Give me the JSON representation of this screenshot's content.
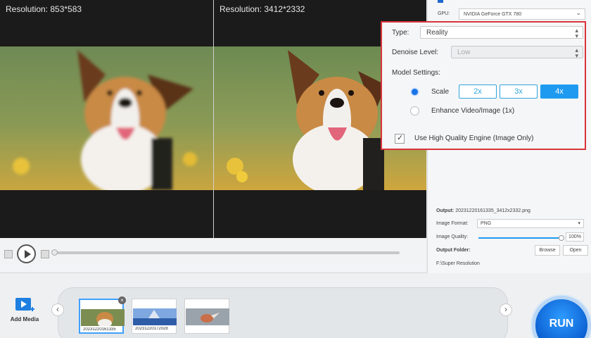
{
  "preview": {
    "left_resolution": "Resolution: 853*583",
    "right_resolution": "Resolution: 3412*2332"
  },
  "settings": {
    "gpu_label": "GPU:",
    "gpu_value": "NVIDIA GeForce GTX 780",
    "type_label": "Type:",
    "type_value": "Reality",
    "denoise_label": "Denoise Level:",
    "denoise_value": "Low",
    "model_label": "Model Settings:",
    "scale_label": "Scale",
    "scale_options": [
      "2x",
      "3x",
      "4x"
    ],
    "scale_selected": "4x",
    "enhance_label": "Enhance Video/Image (1x)",
    "hq_label": "Use High Quality Engine (Image Only)",
    "hq_checked": true
  },
  "output": {
    "output_label": "Output:",
    "output_file": "20231220161335_3412x2332.png",
    "format_label": "Image Format:",
    "format_value": "PNG",
    "quality_label": "Image Quality:",
    "quality_value": "100%",
    "quality_fraction": 1.0,
    "folder_label": "Output Folder:",
    "browse_label": "Browse",
    "open_label": "Open",
    "folder_path": "F:\\Super Resolution"
  },
  "bottom": {
    "add_media_label": "Add Media",
    "thumbnails": [
      {
        "caption": "20231220161335"
      },
      {
        "caption": "20231220172028"
      },
      {
        "caption": ""
      }
    ],
    "run_label": "RUN"
  },
  "colors": {
    "accent": "#1e9bf0",
    "highlight_border": "#d9343b"
  }
}
